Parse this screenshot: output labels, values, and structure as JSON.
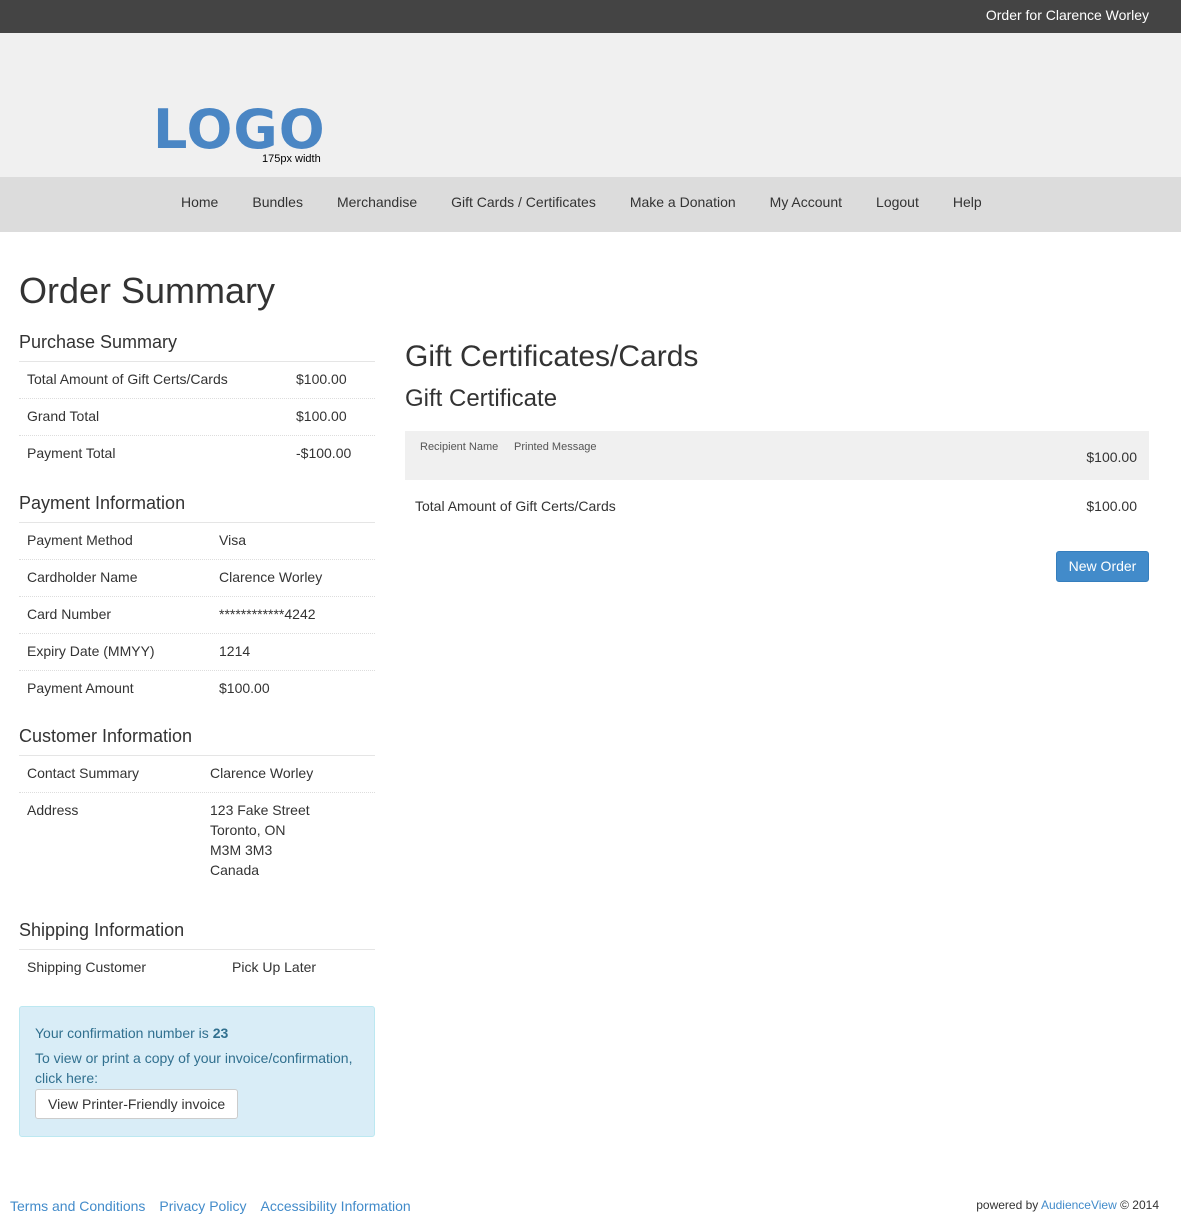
{
  "topbar": {
    "order_for": "Order for Clarence Worley"
  },
  "header": {
    "logo_text": "LOGO",
    "logo_caption": "175px width"
  },
  "nav": {
    "items": [
      {
        "label": "Home"
      },
      {
        "label": "Bundles"
      },
      {
        "label": "Merchandise"
      },
      {
        "label": "Gift Cards / Certificates"
      },
      {
        "label": "Make a Donation"
      },
      {
        "label": "My Account"
      },
      {
        "label": "Logout"
      },
      {
        "label": "Help"
      }
    ]
  },
  "page_title": "Order Summary",
  "purchase_summary": {
    "title": "Purchase Summary",
    "rows": [
      {
        "key": "Total Amount of Gift Certs/Cards",
        "value": "$100.00"
      },
      {
        "key": "Grand Total",
        "value": "$100.00"
      },
      {
        "key": "Payment Total",
        "value": "-$100.00"
      }
    ]
  },
  "payment_info": {
    "title": "Payment Information",
    "rows": [
      {
        "key": "Payment Method",
        "value": "Visa"
      },
      {
        "key": "Cardholder Name",
        "value": "Clarence Worley"
      },
      {
        "key": "Card Number",
        "value": "************4242"
      },
      {
        "key": "Expiry Date (MMYY)",
        "value": "1214"
      },
      {
        "key": "Payment Amount",
        "value": "$100.00"
      }
    ]
  },
  "customer_info": {
    "title": "Customer Information",
    "contact_key": "Contact Summary",
    "contact_value": "Clarence Worley",
    "address_key": "Address",
    "address_lines": [
      "123 Fake Street",
      "Toronto, ON",
      "M3M 3M3",
      "Canada"
    ]
  },
  "shipping_info": {
    "title": "Shipping Information",
    "key": "Shipping Customer",
    "value": "Pick Up Later"
  },
  "confirmation": {
    "prefix": "Your confirmation number is ",
    "number": "23",
    "instructions": "To view or print a copy of your invoice/confirmation, click here:",
    "button_label": "View Printer-Friendly invoice"
  },
  "gift": {
    "title": "Gift Certificates/Cards",
    "subtitle": "Gift Certificate",
    "col_recipient": "Recipient Name",
    "col_message": "Printed Message",
    "item_amount": "$100.00",
    "total_label": "Total Amount of Gift Certs/Cards",
    "total_value": "$100.00",
    "new_order_label": "New Order"
  },
  "footer": {
    "links": [
      "Terms and Conditions",
      "Privacy Policy",
      "Accessibility Information"
    ],
    "powered_prefix": "powered by ",
    "powered_brand": "AudienceView",
    "powered_suffix": " © 2014"
  }
}
